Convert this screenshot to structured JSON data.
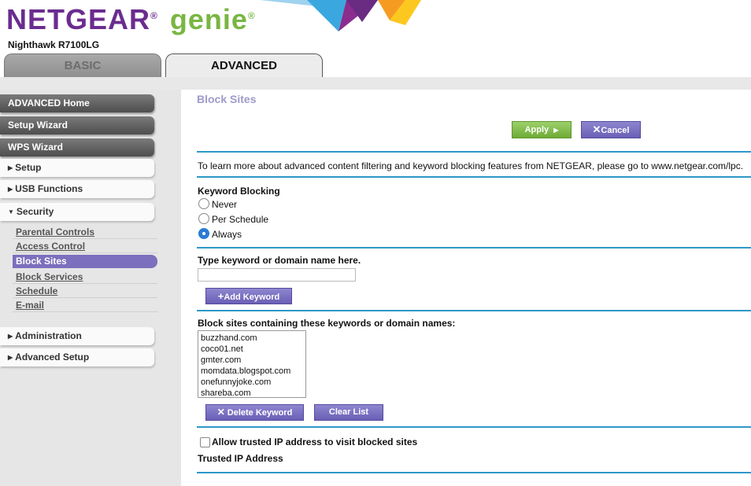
{
  "header": {
    "brand": "NETGEAR",
    "brand_reg": "®",
    "brand_product": "genie",
    "brand_product_reg": "®",
    "model": "Nighthawk R7100LG"
  },
  "tabs": [
    {
      "label": "BASIC",
      "active": false
    },
    {
      "label": "ADVANCED",
      "active": true
    }
  ],
  "sidebar": {
    "top_buttons": [
      "ADVANCED Home",
      "Setup Wizard",
      "WPS Wizard"
    ],
    "sections": [
      {
        "label": "Setup",
        "expanded": false
      },
      {
        "label": "USB Functions",
        "expanded": false
      },
      {
        "label": "Security",
        "expanded": true
      },
      {
        "label": "Administration",
        "expanded": false
      },
      {
        "label": "Advanced Setup",
        "expanded": false
      }
    ],
    "security_items": [
      "Parental Controls",
      "Access Control",
      "Block Sites",
      "Block Services",
      "Schedule",
      "E-mail"
    ],
    "active_item": "Block Sites"
  },
  "main": {
    "title": "Block Sites",
    "apply_label": "Apply",
    "cancel_label": "Cancel",
    "info_text": "To learn more about advanced content filtering and keyword blocking features from NETGEAR, please go to www.netgear.com/lpc.",
    "keyword_blocking_label": "Keyword Blocking",
    "options": [
      "Never",
      "Per Schedule",
      "Always"
    ],
    "selected_option": "Always",
    "keyword_input_label": "Type keyword or domain name here.",
    "keyword_input_value": "",
    "add_keyword_label": "Add Keyword",
    "blocked_list_label": "Block sites containing these keywords or domain names:",
    "blocked_list": [
      "buzzhand.com",
      "coco01.net",
      "gmter.com",
      "momdata.blogspot.com",
      "onefunnyjoke.com",
      "shareba.com"
    ],
    "delete_keyword_label": "Delete Keyword",
    "clear_list_label": "Clear List",
    "allow_trusted_label": "Allow trusted IP address to visit blocked sites",
    "allow_trusted_checked": false,
    "trusted_ip_label": "Trusted IP Address"
  },
  "colors": {
    "accent_blue": "#2d98c8",
    "purple_button": "#6a5fb5",
    "green_button": "#6eab36",
    "title_lavender": "#9d9bc9",
    "active_nav": "#7c6fbd"
  }
}
